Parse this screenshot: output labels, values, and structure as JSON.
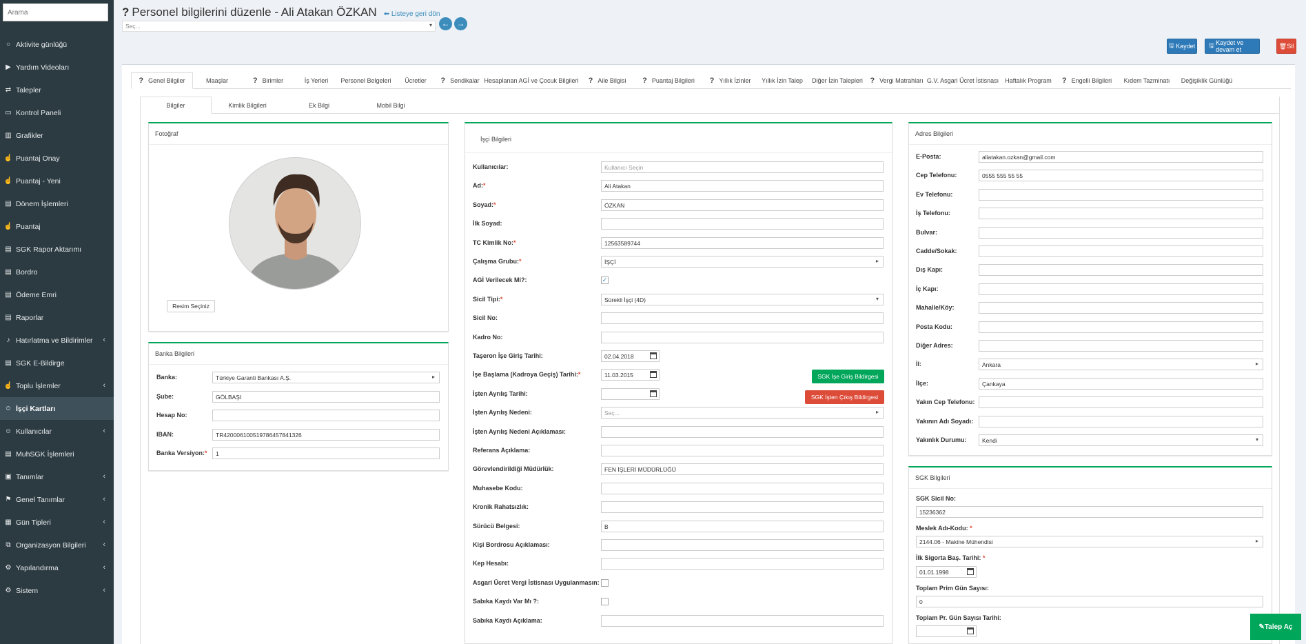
{
  "sidebar": {
    "search_placeholder": "Arama",
    "items": [
      {
        "label": "Aktivite günlüğü",
        "icon": "circle-icon",
        "chev": false
      },
      {
        "label": "Yardım Videoları",
        "icon": "video-icon",
        "chev": false
      },
      {
        "label": "Talepler",
        "icon": "retweet-icon",
        "chev": false
      },
      {
        "label": "Kontrol Paneli",
        "icon": "monitor-icon",
        "chev": false
      },
      {
        "label": "Grafikler",
        "icon": "chart-icon",
        "chev": false
      },
      {
        "label": "Puantaj Onay",
        "icon": "hand-icon",
        "chev": false
      },
      {
        "label": "Puantaj - Yeni",
        "icon": "hand-icon",
        "chev": false
      },
      {
        "label": "Dönem İşlemleri",
        "icon": "file-icon",
        "chev": false
      },
      {
        "label": "Puantaj",
        "icon": "hand-icon",
        "chev": false
      },
      {
        "label": "SGK Rapor Aktarımı",
        "icon": "file-icon",
        "chev": false
      },
      {
        "label": "Bordro",
        "icon": "file-icon",
        "chev": false
      },
      {
        "label": "Ödeme Emri",
        "icon": "file-icon",
        "chev": false
      },
      {
        "label": "Raporlar",
        "icon": "file-icon",
        "chev": false
      },
      {
        "label": "Hatırlatma ve Bildirimler",
        "icon": "bell-icon",
        "chev": true
      },
      {
        "label": "SGK E-Bildirge",
        "icon": "file-icon",
        "chev": false
      },
      {
        "label": "Toplu İşlemler",
        "icon": "hand-icon",
        "chev": true
      },
      {
        "label": "İşçi Kartları",
        "icon": "users-icon",
        "chev": false,
        "active": true
      },
      {
        "label": "Kullanıcılar",
        "icon": "users-icon",
        "chev": true
      },
      {
        "label": "MuhSGK İşlemleri",
        "icon": "file-icon",
        "chev": false
      },
      {
        "label": "Tanımlar",
        "icon": "folder-icon",
        "chev": true
      },
      {
        "label": "Genel Tanımlar",
        "icon": "signpost-icon",
        "chev": true
      },
      {
        "label": "Gün Tipleri",
        "icon": "calendar-icon",
        "chev": true
      },
      {
        "label": "Organizasyon Bilgileri",
        "icon": "sitemap-icon",
        "chev": true
      },
      {
        "label": "Yapılandırma",
        "icon": "gear-icon",
        "chev": true
      },
      {
        "label": "Sistem",
        "icon": "gear-icon",
        "chev": true
      }
    ]
  },
  "header": {
    "q": "?",
    "title": "Personel bilgilerini düzenle - Ali Atakan ÖZKAN",
    "back": "Listeye geri dön",
    "select": "Seç...",
    "save": "Kaydet",
    "save_continue": "Kaydet ve devam et",
    "delete": "Sil"
  },
  "tabs": [
    {
      "label": "Genel Bilgiler",
      "q": true,
      "active": true,
      "w": 90
    },
    {
      "label": "Maaşlar",
      "q": false,
      "w": 70
    },
    {
      "label": "Birimler",
      "q": true,
      "w": 78
    },
    {
      "label": "İş Yerleri",
      "q": false,
      "w": 62
    },
    {
      "label": "Personel Belgeleri",
      "q": false,
      "w": 82
    },
    {
      "label": "Ücretler",
      "q": false,
      "w": 62
    },
    {
      "label": "Sendikalar",
      "q": true,
      "w": 67
    },
    {
      "label": "Hesaplanan AGİ ve Çocuk Bilgileri",
      "q": false,
      "w": 140
    },
    {
      "label": "Aile Bilgisi",
      "q": true,
      "w": 80
    },
    {
      "label": "Puantaj Bilgileri",
      "q": true,
      "w": 98
    },
    {
      "label": "Yıllık İzinler",
      "q": true,
      "w": 81
    },
    {
      "label": "Yıllık İzin Talep",
      "q": false,
      "w": 70
    },
    {
      "label": "Diğer İzin Talepleri",
      "q": false,
      "w": 90
    },
    {
      "label": "Vergi Matrahları",
      "q": true,
      "w": 82
    },
    {
      "label": "G.V. Asgari Ücret İstisnası",
      "q": false,
      "w": 110
    },
    {
      "label": "Haftalık Program",
      "q": false,
      "w": 80
    },
    {
      "label": "Engelli Bilgileri",
      "q": true,
      "w": 90
    },
    {
      "label": "Kıdem Tazminatı",
      "q": false,
      "w": 84
    },
    {
      "label": "Değişiklik Günlüğü",
      "q": false,
      "w": 90
    }
  ],
  "subtabs": [
    {
      "label": "Bilgiler",
      "active": true,
      "w": 104
    },
    {
      "label": "Kimlik Bilgileri",
      "w": 104
    },
    {
      "label": "Ek Bilgi",
      "w": 104
    },
    {
      "label": "Mobil Bilgi",
      "w": 104
    }
  ],
  "photo_panel": {
    "title": "Fotoğraf",
    "button": "Resim Seçiniz"
  },
  "bank": {
    "title": "Banka Bilgileri",
    "rows": [
      {
        "label": "Banka:",
        "value": "Türkiye Garanti Bankası A.Ş.",
        "type": "select"
      },
      {
        "label": "Şube:",
        "value": "GÖLBAŞI"
      },
      {
        "label": "Hesap No:",
        "value": ""
      },
      {
        "label": "IBAN:",
        "value": "TR420006100519786457841326"
      },
      {
        "label": "Banka Versiyon:",
        "value": "1",
        "req": true
      }
    ]
  },
  "worker": {
    "title": "İşçi Bilgileri",
    "rows": [
      {
        "label": "Kullanıcılar:",
        "value": "Kullanıcı Seçin",
        "ph": true
      },
      {
        "label": "Ad:",
        "value": "Ali Atakan",
        "req": true
      },
      {
        "label": "Soyad:",
        "value": "ÖZKAN",
        "req": true
      },
      {
        "label": "İlk Soyad:",
        "value": ""
      },
      {
        "label": "TC Kimlik No:",
        "value": "12563589744",
        "req": true
      },
      {
        "label": "Çalışma Grubu:",
        "value": "İŞÇİ",
        "req": true,
        "type": "select"
      },
      {
        "label": "AGİ Verilecek Mi?:",
        "type": "check",
        "checked": true
      },
      {
        "label": "Sicil Tipi:",
        "value": "Sürekli İşçi (4D)",
        "req": true,
        "type": "dropdown"
      },
      {
        "label": "Sicil No:",
        "value": ""
      },
      {
        "label": "Kadro No:",
        "value": ""
      },
      {
        "label": "Taşeron İşe Giriş Tarihi:",
        "value": "02.04.2018",
        "type": "date"
      },
      {
        "label": "İşe Başlama (Kadroya Geçiş) Tarihi:",
        "value": "11.03.2015",
        "req": true,
        "type": "date"
      },
      {
        "label": "İşten Ayrılış Tarihi:",
        "value": "",
        "type": "date"
      },
      {
        "label": "İşten Ayrılış Nedeni:",
        "value": "Seç...",
        "ph": true,
        "type": "select"
      },
      {
        "label": "İşten Ayrılış Nedeni Açıklaması:",
        "value": ""
      },
      {
        "label": "Referans Açıklama:",
        "value": ""
      },
      {
        "label": "Görevlendirildiği Müdürlük:",
        "value": "FEN İŞLERİ MÜDÜRLÜĞÜ"
      },
      {
        "label": "Muhasebe Kodu:",
        "value": ""
      },
      {
        "label": "Kronik Rahatsızlık:",
        "value": ""
      },
      {
        "label": "Sürücü Belgesi:",
        "value": "B"
      },
      {
        "label": "Kişi Bordrosu Açıklaması:",
        "value": ""
      },
      {
        "label": "Kep Hesabı:",
        "value": ""
      },
      {
        "label": "Asgari Ücret Vergi İstisnası Uygulanmasın:",
        "type": "check",
        "checked": false
      },
      {
        "label": "Sabıka Kaydı Var Mı ?:",
        "type": "check",
        "checked": false
      },
      {
        "label": "Sabıka Kaydı Açıklama:",
        "value": ""
      }
    ],
    "sgk_in": "SGK İşe Giriş Bildirgesi",
    "sgk_out": "SGK İşten Çıkış Bildirgesi"
  },
  "address": {
    "title": "Adres Bilgileri",
    "rows": [
      {
        "label": "E-Posta:",
        "value": "aliatakan.ozkan@gmail.com"
      },
      {
        "label": "Cep Telefonu:",
        "value": "0555 555 55 55"
      },
      {
        "label": "Ev Telefonu:",
        "value": ""
      },
      {
        "label": "İş Telefonu:",
        "value": ""
      },
      {
        "label": "Bulvar:",
        "value": ""
      },
      {
        "label": "Cadde/Sokak:",
        "value": ""
      },
      {
        "label": "Dış Kapı:",
        "value": ""
      },
      {
        "label": "İç Kapı:",
        "value": ""
      },
      {
        "label": "Mahalle/Köy:",
        "value": ""
      },
      {
        "label": "Posta Kodu:",
        "value": ""
      },
      {
        "label": "Diğer Adres:",
        "value": ""
      },
      {
        "label": "İl:",
        "value": "Ankara",
        "type": "select"
      },
      {
        "label": "İlçe:",
        "value": "Çankaya"
      },
      {
        "label": "Yakın Cep Telefonu:",
        "value": ""
      },
      {
        "label": "Yakının Adı Soyadı:",
        "value": ""
      },
      {
        "label": "Yakınlık Durumu:",
        "value": "Kendi",
        "type": "dropdown"
      }
    ]
  },
  "sgk": {
    "title": "SGK Bilgileri",
    "sicil_label": "SGK Sicil No:",
    "sicil": "15236362",
    "meslek_label": "Meslek Adı-Kodu:",
    "meslek": "2144.06 - Makine Mühendisi",
    "ilk_label": "İlk Sigorta Baş. Tarihi:",
    "ilk": "01.01.1998",
    "prim_label": "Toplam Prim Gün Sayısı:",
    "prim": "0",
    "prim_tarih_label": "Toplam Pr. Gün Sayısı Tarihi:",
    "prim_tarih": ""
  },
  "talep": "Talep Aç"
}
